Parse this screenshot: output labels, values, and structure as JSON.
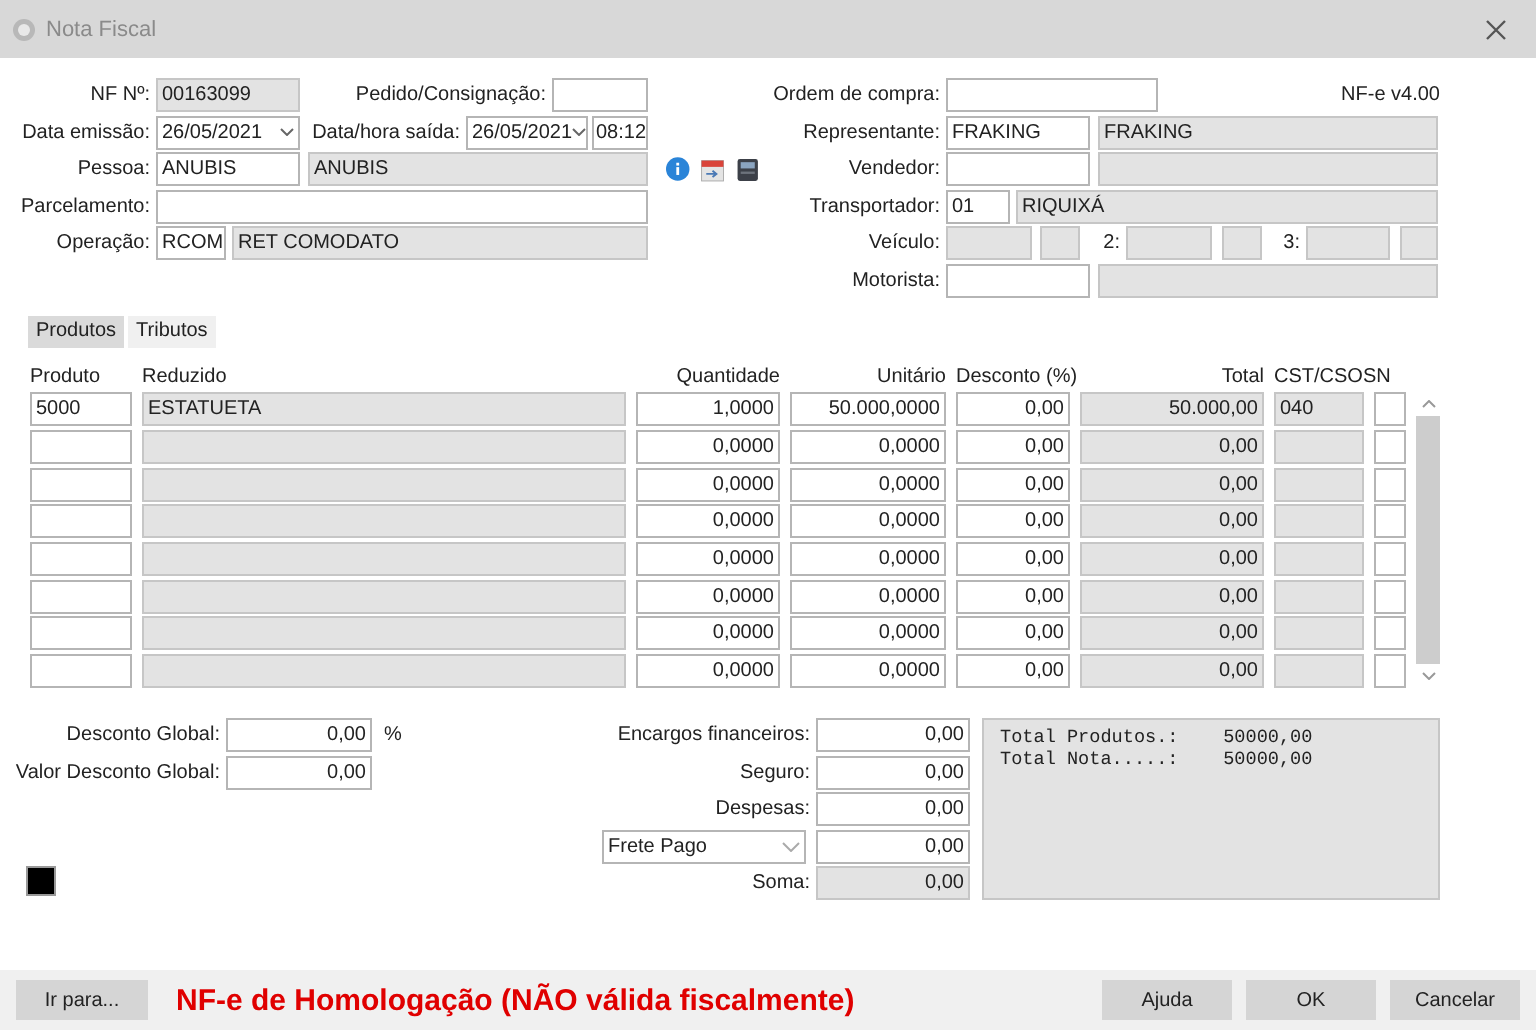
{
  "window": {
    "title": "Nota Fiscal"
  },
  "nf_number": {
    "label": "NF Nº:",
    "value": "00163099"
  },
  "pedido": {
    "label": "Pedido/Consignação:"
  },
  "data_emissao": {
    "label": "Data emissão:",
    "value": "26/05/2021"
  },
  "data_saida": {
    "label": "Data/hora saída:",
    "date": "26/05/2021",
    "time": "08:12"
  },
  "pessoa": {
    "label": "Pessoa:",
    "code": "ANUBIS",
    "name": "ANUBIS"
  },
  "parcelamento": {
    "label": "Parcelamento:"
  },
  "operacao": {
    "label": "Operação:",
    "code": "RCOM",
    "name": "RET COMODATO"
  },
  "ordem_compra": {
    "label": "Ordem de compra:"
  },
  "version": "NF-e v4.00",
  "representante": {
    "label": "Representante:",
    "code": "FRAKING",
    "name": "FRAKING"
  },
  "vendedor": {
    "label": "Vendedor:"
  },
  "transportador": {
    "label": "Transportador:",
    "code": "01",
    "name": "RIQUIXÁ"
  },
  "veiculo": {
    "label": "Veículo:",
    "label_2": "2:",
    "label_3": "3:"
  },
  "motorista": {
    "label": "Motorista:"
  },
  "tabs": [
    {
      "label": "Produtos",
      "selected": true
    },
    {
      "label": "Tributos",
      "selected": false
    }
  ],
  "items": {
    "columns": [
      "Produto",
      "Reduzido",
      "Quantidade",
      "Unitário",
      "Desconto (%)",
      "Total",
      "CST/CSOSN"
    ],
    "rows": [
      {
        "produto": "5000",
        "reduzido": "ESTATUETA",
        "quantidade": "1,0000",
        "unitario": "50.000,0000",
        "desconto": "0,00",
        "total": "50.000,00",
        "cst": "040"
      },
      {
        "quantidade": "0,0000",
        "unitario": "0,0000",
        "desconto": "0,00",
        "total": "0,00"
      },
      {
        "quantidade": "0,0000",
        "unitario": "0,0000",
        "desconto": "0,00",
        "total": "0,00"
      },
      {
        "quantidade": "0,0000",
        "unitario": "0,0000",
        "desconto": "0,00",
        "total": "0,00"
      },
      {
        "quantidade": "0,0000",
        "unitario": "0,0000",
        "desconto": "0,00",
        "total": "0,00"
      },
      {
        "quantidade": "0,0000",
        "unitario": "0,0000",
        "desconto": "0,00",
        "total": "0,00"
      },
      {
        "quantidade": "0,0000",
        "unitario": "0,0000",
        "desconto": "0,00",
        "total": "0,00"
      },
      {
        "quantidade": "0,0000",
        "unitario": "0,0000",
        "desconto": "0,00",
        "total": "0,00"
      }
    ]
  },
  "desconto_global": {
    "label": "Desconto Global:",
    "value": "0,00",
    "unit": "%"
  },
  "valor_desconto": {
    "label": "Valor Desconto Global:",
    "value": "0,00"
  },
  "charges": [
    {
      "kind": "labeled",
      "label": "Encargos financeiros:",
      "value": "0,00"
    },
    {
      "kind": "labeled",
      "label": "Seguro:",
      "value": "0,00"
    },
    {
      "kind": "labeled",
      "label": "Despesas:",
      "value": "0,00"
    },
    {
      "kind": "select",
      "option": "Frete Pago",
      "value": "0,00"
    },
    {
      "kind": "total",
      "label": "Soma:",
      "value": "0,00"
    }
  ],
  "summary": [
    "Total Produtos.:    50000,00",
    "Total Nota.....:    50000,00"
  ],
  "footer": {
    "goto_button": "Ir para...",
    "warning": "NF-e de Homologação (NÃO válida fiscalmente)",
    "buttons": [
      "Ajuda",
      "OK",
      "Cancelar"
    ]
  }
}
